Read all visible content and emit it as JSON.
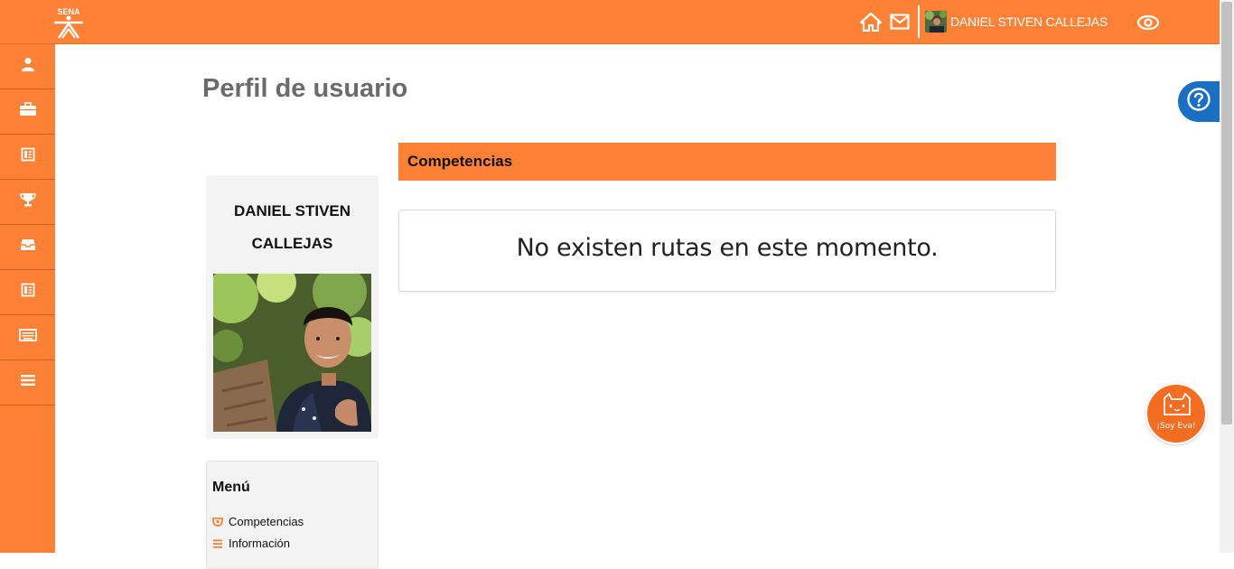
{
  "colors": {
    "brand": "#ff8136",
    "help": "#1a6fc4",
    "eva": "#f46d21"
  },
  "header": {
    "logo_text": "SENA",
    "user_name": "DANIEL STIVEN CALLEJAS",
    "icons": [
      "home-icon",
      "mail-icon",
      "eye-icon"
    ]
  },
  "sidebar": {
    "items": [
      {
        "icon": "user-icon"
      },
      {
        "icon": "briefcase-icon"
      },
      {
        "icon": "card-icon"
      },
      {
        "icon": "trophy-icon"
      },
      {
        "icon": "inbox-icon"
      },
      {
        "icon": "card-icon"
      },
      {
        "icon": "keyboard-icon"
      },
      {
        "icon": "menu-icon"
      }
    ]
  },
  "page": {
    "title": "Perfil de usuario"
  },
  "profile": {
    "name": "DANIEL STIVEN CALLEJAS"
  },
  "menu": {
    "title": "Menú",
    "items": [
      {
        "label": "Competencias",
        "icon": "badge-icon"
      },
      {
        "label": "Información",
        "icon": "list-icon"
      }
    ]
  },
  "competencias": {
    "header": "Competencias",
    "empty_message": "No existen rutas en este momento."
  },
  "floating": {
    "help_icon": "question-icon",
    "eva_label": "¡Soy Eva!"
  }
}
